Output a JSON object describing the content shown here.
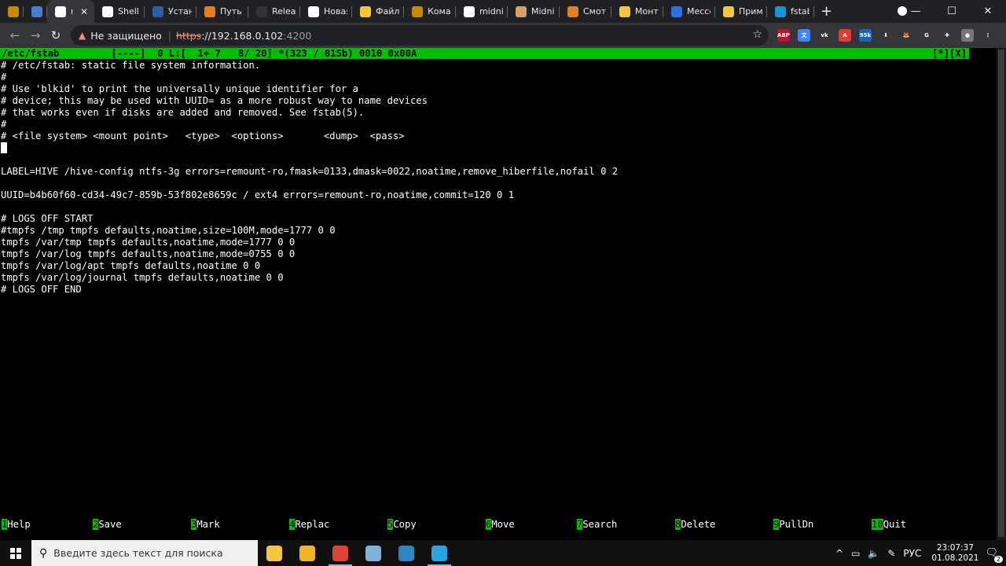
{
  "browser": {
    "tabs": [
      {
        "title": "",
        "icon": "mining-icon",
        "color": "#c68a00"
      },
      {
        "title": "",
        "icon": "document-icon",
        "color": "#4a7bd0"
      },
      {
        "title": "mc",
        "icon": "terminal-icon",
        "color": "#ffffff",
        "active": true
      },
      {
        "title": "Shell In",
        "icon": "terminal-icon",
        "color": "#ffffff"
      },
      {
        "title": "Устано",
        "icon": "mc-icon",
        "color": "#2c5ea8"
      },
      {
        "title": "Путь к",
        "icon": "orange-circle-icon",
        "color": "#e67e22"
      },
      {
        "title": "Release",
        "icon": "github-icon",
        "color": "#333333"
      },
      {
        "title": "Новая",
        "icon": "chrome-icon",
        "color": "#ffffff"
      },
      {
        "title": "Файло",
        "icon": "yellow-circle-icon",
        "color": "#f4c542"
      },
      {
        "title": "Коман",
        "icon": "mining-icon",
        "color": "#c68a00"
      },
      {
        "title": "midnig",
        "icon": "google-icon",
        "color": "#ffffff"
      },
      {
        "title": "Midnig",
        "icon": "book-icon",
        "color": "#d9a066"
      },
      {
        "title": "Смотр",
        "icon": "orange-circle-icon",
        "color": "#e67e22"
      },
      {
        "title": "Монти",
        "icon": "yellow-circle-icon",
        "color": "#f4c542"
      },
      {
        "title": "Мессе",
        "icon": "message-icon",
        "color": "#2f6fe4"
      },
      {
        "title": "Приме",
        "icon": "star-icon",
        "color": "#f4c542"
      },
      {
        "title": "fstab -",
        "icon": "arch-icon",
        "color": "#1793d1"
      }
    ],
    "close_glyph": "✕",
    "newtab_glyph": "+",
    "window_controls": {
      "minimize": "—",
      "maximize": "☐",
      "close": "✕"
    },
    "address": {
      "warning": "Не защищено",
      "separator": "|",
      "scheme": "https",
      "host": "://192.168.0.102",
      "port": ":4200"
    },
    "extensions": [
      {
        "label": "ABP",
        "color": "#c70d2c"
      },
      {
        "label": "文",
        "color": "#4285f4"
      },
      {
        "label": "vk",
        "color": "#35363a"
      },
      {
        "label": "A",
        "color": "#e53935"
      },
      {
        "label": "95k",
        "color": "#1565c0"
      },
      {
        "label": "⬇",
        "color": "#35363a"
      },
      {
        "label": "🦊",
        "color": "#35363a"
      },
      {
        "label": "G",
        "color": "#35363a"
      },
      {
        "label": "✚",
        "color": "#35363a"
      },
      {
        "label": "●",
        "color": "#777777"
      },
      {
        "label": "⋮",
        "color": "#35363a"
      }
    ]
  },
  "editor": {
    "status_left": "/etc/fstab         [----]  0 L:[  1+ 7   8/ 20] *(323 / 815b) 0010 0x00A",
    "status_right": "[*][X]",
    "lines": [
      "# /etc/fstab: static file system information.",
      "#",
      "# Use 'blkid' to print the universally unique identifier for a",
      "# device; this may be used with UUID= as a more robust way to name devices",
      "# that works even if disks are added and removed. See fstab(5).",
      "#",
      "# <file system> <mount point>   <type>  <options>       <dump>  <pass>",
      "",
      "",
      "LABEL=HIVE /hive-config ntfs-3g errors=remount-ro,fmask=0133,dmask=0022,noatime,remove_hiberfile,nofail 0 2",
      "",
      "UUID=b4b60f60-cd34-49c7-859b-53f802e8659c / ext4 errors=remount-ro,noatime,commit=120 0 1",
      "",
      "# LOGS OFF START",
      "#tmpfs /tmp tmpfs defaults,noatime,size=100M,mode=1777 0 0",
      "tmpfs /var/tmp tmpfs defaults,noatime,mode=1777 0 0",
      "tmpfs /var/log tmpfs defaults,noatime,mode=0755 0 0",
      "tmpfs /var/log/apt tmpfs defaults,noatime 0 0",
      "tmpfs /var/log/journal tmpfs defaults,noatime 0 0",
      "# LOGS OFF END"
    ],
    "fnkeys": [
      {
        "num": "1",
        "label": "Help"
      },
      {
        "num": "2",
        "label": "Save"
      },
      {
        "num": "3",
        "label": "Mark"
      },
      {
        "num": "4",
        "label": "Replac"
      },
      {
        "num": "5",
        "label": "Copy"
      },
      {
        "num": "6",
        "label": "Move"
      },
      {
        "num": "7",
        "label": "Search"
      },
      {
        "num": "8",
        "label": "Delete"
      },
      {
        "num": "9",
        "label": "PullDn"
      },
      {
        "num": "10",
        "label": "Quit"
      }
    ]
  },
  "taskbar": {
    "search_placeholder": "Введите здесь текст для поиска",
    "apps": [
      {
        "name": "yellow-app",
        "color": "#f4c542"
      },
      {
        "name": "file-explorer",
        "color": "#f0b429"
      },
      {
        "name": "chrome",
        "color": "#db4437",
        "running": true
      },
      {
        "name": "notepad",
        "color": "#7fb3d5"
      },
      {
        "name": "network-app",
        "color": "#2e86c1"
      },
      {
        "name": "telegram",
        "color": "#2aa3e0",
        "running": true
      }
    ],
    "tray": {
      "chevron": "^",
      "lang": "РУС",
      "time": "23:07:37",
      "date": "01.08.2021",
      "notifications": "2"
    }
  }
}
